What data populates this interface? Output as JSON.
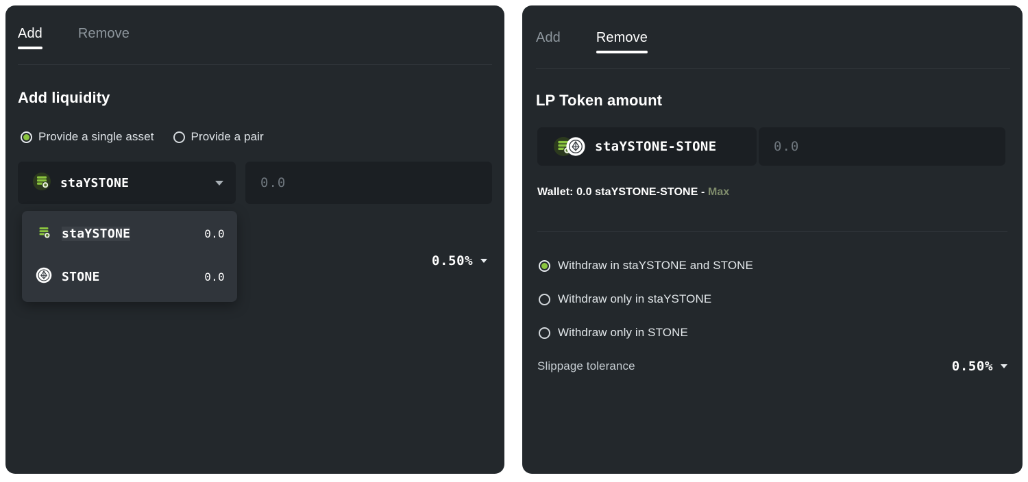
{
  "page": {
    "background": "#ffffff",
    "panel_bg": "#23282c",
    "field_bg": "#1b1f23",
    "dropdown_bg": "#30353b",
    "accent_green": "#8bc53f",
    "muted_green": "#7e8b6b",
    "text_primary": "#ffffff",
    "text_muted": "#8d969d"
  },
  "left_panel": {
    "tabs": [
      {
        "label": "Add",
        "active": true
      },
      {
        "label": "Remove",
        "active": false
      }
    ],
    "heading": "Add liquidity",
    "mode_options": [
      {
        "label": "Provide a single asset",
        "selected": true
      },
      {
        "label": "Provide a pair",
        "selected": false
      }
    ],
    "token_select": {
      "icon": "staystone-token-icon",
      "token": "staYSTONE",
      "caret": "chevron-down-icon"
    },
    "amount_input": {
      "value": "",
      "placeholder": "0.0"
    },
    "dropdown": {
      "open": true,
      "items": [
        {
          "icon": "staystone-token-icon",
          "token": "staYSTONE",
          "balance": "0.0",
          "highlighted": true
        },
        {
          "icon": "stone-token-icon",
          "token": "STONE",
          "balance": "0.0",
          "highlighted": false
        }
      ]
    },
    "slippage": {
      "value": "0.50%",
      "caret": "chevron-down-icon"
    }
  },
  "right_panel": {
    "tabs": [
      {
        "label": "Add",
        "active": false
      },
      {
        "label": "Remove",
        "active": true
      }
    ],
    "heading": "LP Token amount",
    "lp_token": {
      "icon": "lp-pair-icon",
      "name": "staYSTONE-STONE"
    },
    "amount_input": {
      "value": "",
      "placeholder": "0.0"
    },
    "wallet": {
      "prefix": "Wallet: 0.0 staYSTONE-STONE - ",
      "max_label": "Max"
    },
    "withdraw_options": [
      {
        "label": "Withdraw in staYSTONE and STONE",
        "selected": true
      },
      {
        "label": "Withdraw only in staYSTONE",
        "selected": false
      },
      {
        "label": "Withdraw only in STONE",
        "selected": false
      }
    ],
    "slippage": {
      "label": "Slippage tolerance",
      "value": "0.50%",
      "caret": "chevron-down-icon"
    }
  }
}
